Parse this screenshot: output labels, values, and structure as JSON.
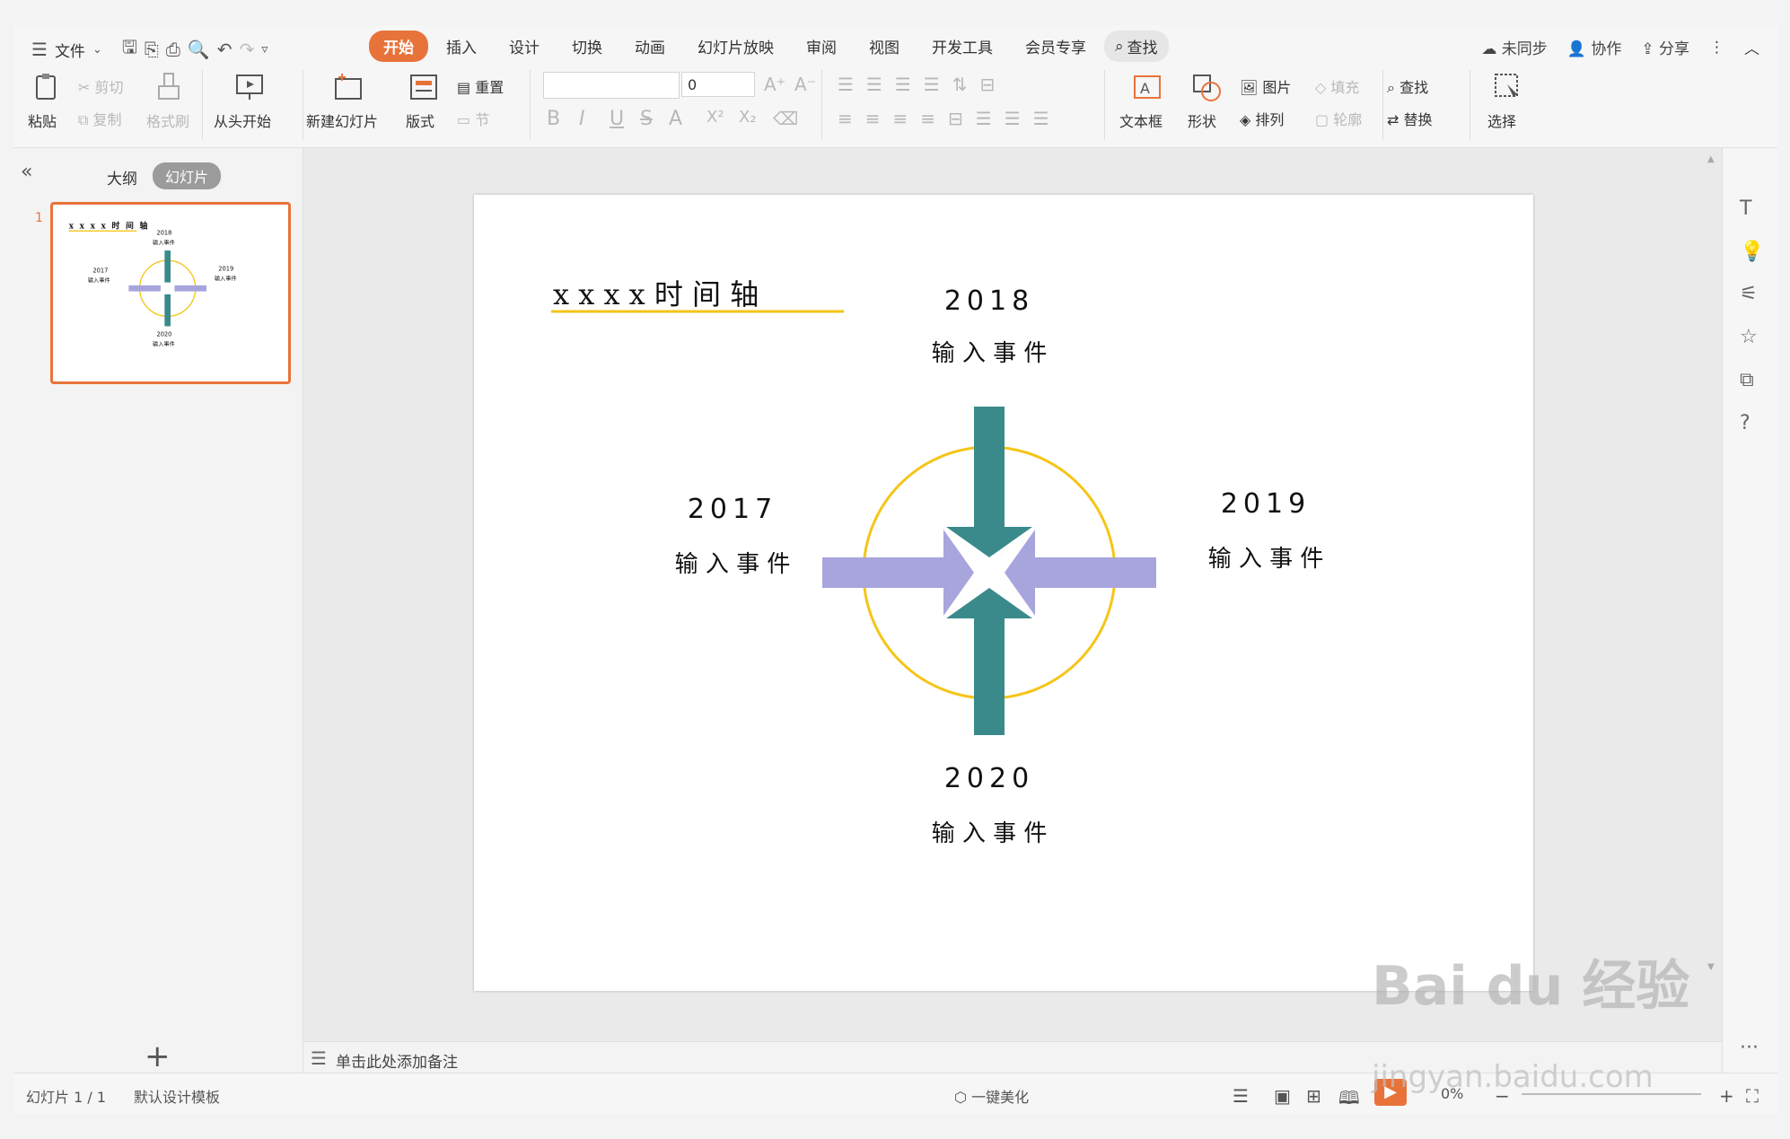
{
  "menubar": {
    "menu_label": "文件",
    "tabs": [
      "开始",
      "插入",
      "设计",
      "切换",
      "动画",
      "幻灯片放映",
      "审阅",
      "视图",
      "开发工具",
      "会员专享"
    ],
    "active_tab": "开始",
    "search_label": "查找",
    "sync_label": "未同步",
    "collab_label": "协作",
    "share_label": "分享"
  },
  "ribbon": {
    "paste": "粘贴",
    "cut": "剪切",
    "copy": "复制",
    "format_painter": "格式刷",
    "from_start": "从头开始",
    "new_slide": "新建幻灯片",
    "layout": "版式",
    "reset": "重置",
    "section": "节",
    "font_size_value": "0",
    "textbox": "文本框",
    "shape": "形状",
    "picture": "图片",
    "fill": "填充",
    "arrange": "排列",
    "outline": "轮廓",
    "find": "查找",
    "replace": "替换",
    "select": "选择"
  },
  "leftpanel": {
    "outline_tab": "大纲",
    "slides_tab": "幻灯片",
    "slide_number": "1"
  },
  "slide": {
    "title": "x x x x 时 间 轴",
    "events": [
      {
        "year": "2018",
        "text": "输 入 事 件"
      },
      {
        "year": "2017",
        "text": "输 入 事 件"
      },
      {
        "year": "2019",
        "text": "输 入 事 件"
      },
      {
        "year": "2020",
        "text": "输 入 事 件"
      }
    ],
    "colors": {
      "circle": "#f5c518",
      "vertical_arrows": "#3a8a8c",
      "horizontal_arrows": "#a8a4dc",
      "title_underline": "#f5c518"
    }
  },
  "notes": {
    "placeholder": "单击此处添加备注"
  },
  "statusbar": {
    "slide_counter": "幻灯片 1 / 1",
    "template": "默认设计模板",
    "beautify": "一键美化",
    "zoom": "0%"
  },
  "watermark": {
    "line1": "Bai du 经验",
    "line2": "jingyan.baidu.com"
  }
}
